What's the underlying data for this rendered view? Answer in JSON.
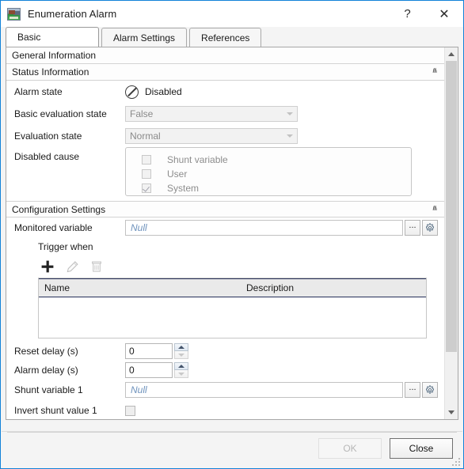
{
  "window": {
    "title": "Enumeration Alarm",
    "icon": "image-thumbnail-icon",
    "help_label": "?",
    "close_label": "✕",
    "border_color": "#1282d8"
  },
  "tabs": [
    {
      "label": "Basic",
      "selected": true
    },
    {
      "label": "Alarm Settings",
      "selected": false
    },
    {
      "label": "References",
      "selected": false
    }
  ],
  "groups": {
    "general": {
      "title": "General Information",
      "chevron": "ⱟ",
      "expanded": false
    },
    "status": {
      "title": "Status Information",
      "chevron": "ⱞ",
      "expanded": true
    },
    "configuration": {
      "title": "Configuration Settings",
      "chevron": "ⱞ",
      "expanded": true
    }
  },
  "status_information": {
    "alarm_state": {
      "label": "Alarm state",
      "value": "Disabled",
      "icon": "no-entry-icon"
    },
    "basic_evaluation_state": {
      "label": "Basic evaluation state",
      "value": "False",
      "disabled": true
    },
    "evaluation_state": {
      "label": "Evaluation state",
      "value": "Normal",
      "disabled": true
    },
    "disabled_cause": {
      "label": "Disabled cause",
      "items": [
        {
          "label": "Shunt variable",
          "checked": false
        },
        {
          "label": "User",
          "checked": false
        },
        {
          "label": "System",
          "checked": true
        }
      ]
    }
  },
  "configuration_settings": {
    "monitored_variable": {
      "label": "Monitored variable",
      "value": "Null",
      "browse_label": "...",
      "config_icon": "gear-icon"
    },
    "trigger_when": {
      "label": "Trigger when",
      "toolbar": [
        {
          "name": "add-icon",
          "glyph": "+",
          "enabled": true
        },
        {
          "name": "edit-pencil-icon",
          "glyph": "✎",
          "enabled": false
        },
        {
          "name": "delete-trash-icon",
          "glyph": "🗑",
          "enabled": false
        }
      ],
      "columns": [
        "Name",
        "Description"
      ],
      "rows": []
    },
    "reset_delay": {
      "label": "Reset delay (s)",
      "value": "0"
    },
    "alarm_delay": {
      "label": "Alarm delay (s)",
      "value": "0"
    },
    "shunt_variable_1": {
      "label": "Shunt variable 1",
      "value": "Null",
      "browse_label": "...",
      "config_icon": "gear-icon"
    },
    "invert_shunt_value_1": {
      "label": "Invert shunt value 1",
      "checked": false
    }
  },
  "footer": {
    "ok_label": "OK",
    "ok_enabled": false,
    "close_label": "Close",
    "close_enabled": true
  },
  "scrollbar": {
    "up_arrow": "▲",
    "down_arrow": "▼",
    "thumb_position_pct": 0,
    "thumb_size_pct": 85
  }
}
